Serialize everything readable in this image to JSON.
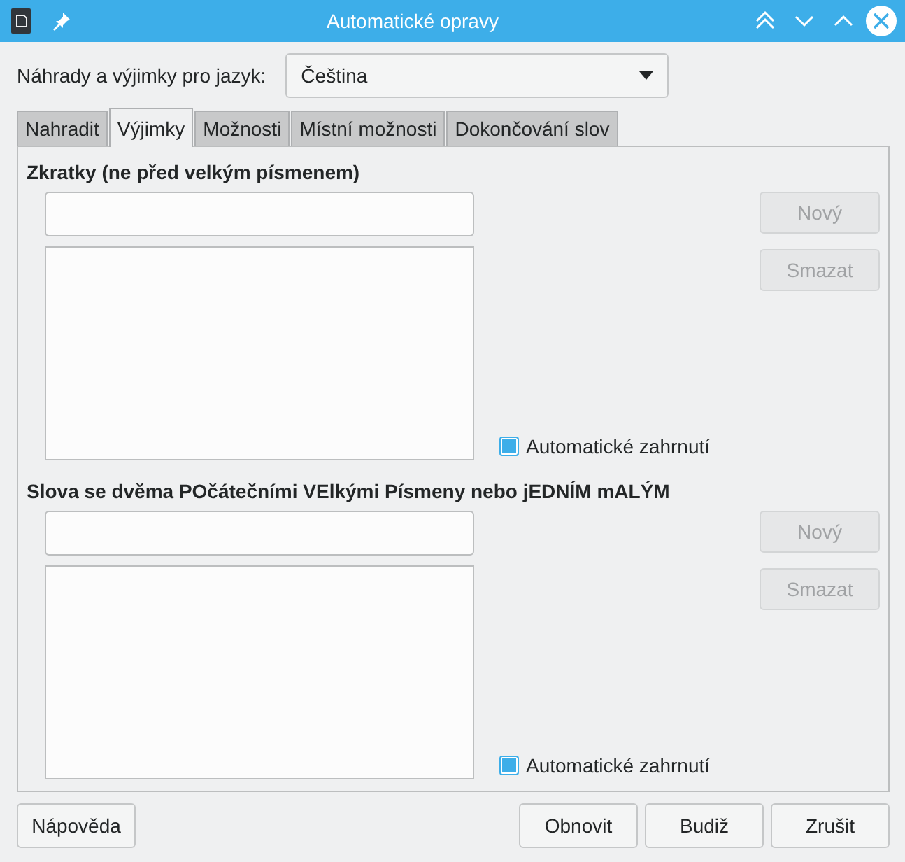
{
  "window": {
    "title": "Automatické opravy"
  },
  "language": {
    "label": "Náhrady a výjimky pro jazyk:",
    "value": "Čeština"
  },
  "tabs": [
    {
      "label": "Nahradit",
      "selected": false
    },
    {
      "label": "Výjimky",
      "selected": true
    },
    {
      "label": "Možnosti",
      "selected": false
    },
    {
      "label": "Místní možnosti",
      "selected": false
    },
    {
      "label": "Dokončování slov",
      "selected": false
    }
  ],
  "sections": [
    {
      "title": "Zkratky (ne před velkým písmenem)",
      "buttons": [
        {
          "label": "Nový",
          "disabled": true
        },
        {
          "label": "Smazat",
          "disabled": true
        }
      ],
      "checkbox": {
        "label": "Automatické zahrnutí",
        "checked": true
      }
    },
    {
      "title": "Slova se dvěma POčátečními VElkými Písmeny nebo jEDNÍM mALÝM",
      "buttons": [
        {
          "label": "Nový",
          "disabled": true
        },
        {
          "label": "Smazat",
          "disabled": true
        }
      ],
      "checkbox": {
        "label": "Automatické zahrnutí",
        "checked": true
      }
    }
  ],
  "footer": {
    "help": "Nápověda",
    "buttons": [
      "Obnovit",
      "Budiž",
      "Zrušit"
    ]
  }
}
